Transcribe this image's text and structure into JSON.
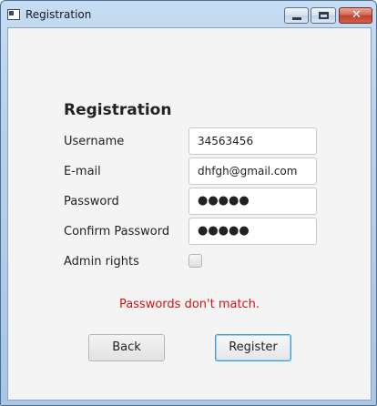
{
  "window": {
    "title": "Registration",
    "controls": {
      "minimize": "minimize-icon",
      "maximize": "maximize-icon",
      "close": "close-icon",
      "close_glyph": "✕"
    }
  },
  "form": {
    "heading": "Registration",
    "username": {
      "label": "Username",
      "value": "34563456"
    },
    "email": {
      "label": "E-mail",
      "value": "dhfgh@gmail.com"
    },
    "password": {
      "label": "Password",
      "value": "●●●●●"
    },
    "confirm_password": {
      "label": "Confirm Password",
      "value": "●●●●●"
    },
    "admin_rights": {
      "label": "Admin rights",
      "checked": false
    },
    "error_message": "Passwords don't match.",
    "back_label": "Back",
    "register_label": "Register"
  },
  "colors": {
    "error": "#d11212",
    "focus_border": "#3d9ad6",
    "background": "#f4f4f4"
  }
}
